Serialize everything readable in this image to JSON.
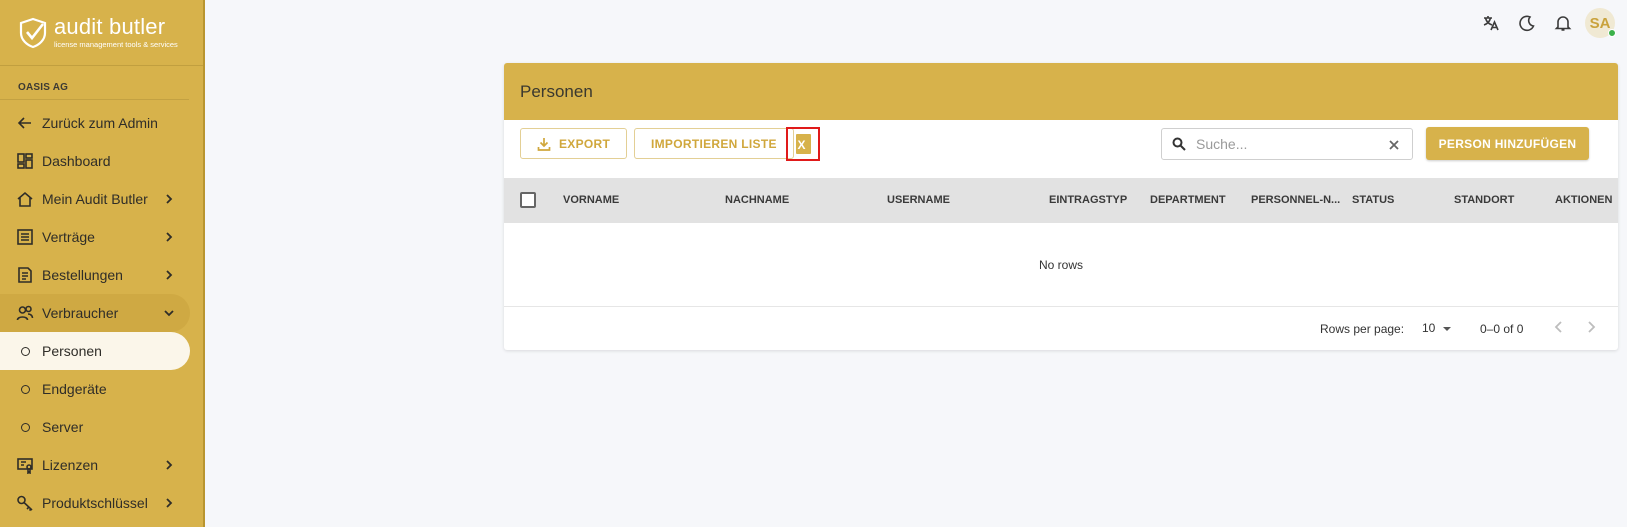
{
  "brand": {
    "title": "audit butler",
    "subtitle": "license management tools & services"
  },
  "org_name": "OASIS AG",
  "sidebar": {
    "items": [
      {
        "label": "Zurück zum Admin"
      },
      {
        "label": "Dashboard"
      },
      {
        "label": "Mein Audit Butler"
      },
      {
        "label": "Verträge"
      },
      {
        "label": "Bestellungen"
      },
      {
        "label": "Verbraucher"
      },
      {
        "label": "Personen"
      },
      {
        "label": "Endgeräte"
      },
      {
        "label": "Server"
      },
      {
        "label": "Lizenzen"
      },
      {
        "label": "Produktschlüssel"
      }
    ]
  },
  "topbar": {
    "avatar_initials": "SA"
  },
  "card": {
    "title": "Personen",
    "export_label": "EXPORT",
    "import_label": "IMPORTIEREN LISTE",
    "search_placeholder": "Suche...",
    "add_label": "PERSON HINZUFÜGEN",
    "columns": [
      "VORNAME",
      "NACHNAME",
      "USERNAME",
      "EINTRAGSTYP",
      "DEPARTMENT",
      "PERSONNEL-N...",
      "STATUS",
      "STANDORT",
      "AKTIONEN"
    ],
    "empty_text": "No rows",
    "rows_per_page_label": "Rows per page:",
    "rows_per_page_value": "10",
    "range_text": "0–0 of 0"
  },
  "colors": {
    "accent": "#d7b24b",
    "highlight": "#e01a1a"
  }
}
